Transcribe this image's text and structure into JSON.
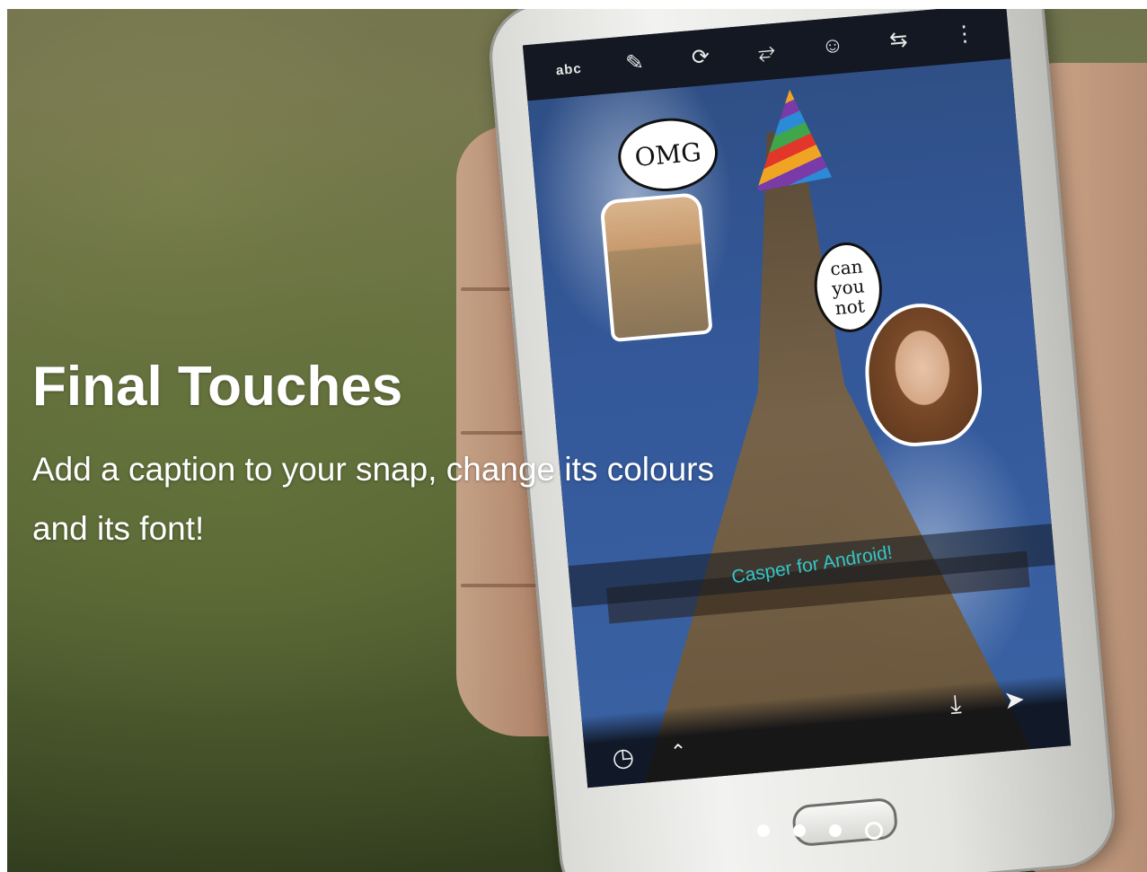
{
  "intro": {
    "title": "Final Touches",
    "description": "Add a caption to your snap, change its colours and its font!"
  },
  "phone_screen": {
    "toolbar": {
      "text_tool": "abc",
      "icons": [
        "brush-icon",
        "rotate-icon",
        "fullscreen-icon",
        "emoji-icon",
        "swap-icon",
        "more-icon"
      ]
    },
    "caption": "Casper for Android!",
    "stickers": {
      "omg_bubble": "OMG",
      "can_you_not_bubble": "can you not"
    },
    "bottom_icons": [
      "timer-icon",
      "chevron-up-icon",
      "download-icon",
      "send-icon"
    ]
  },
  "pagination": {
    "total": 4,
    "active_index": 3
  },
  "colors": {
    "caption_text": "#33c6c6",
    "headline": "#ffffff"
  }
}
